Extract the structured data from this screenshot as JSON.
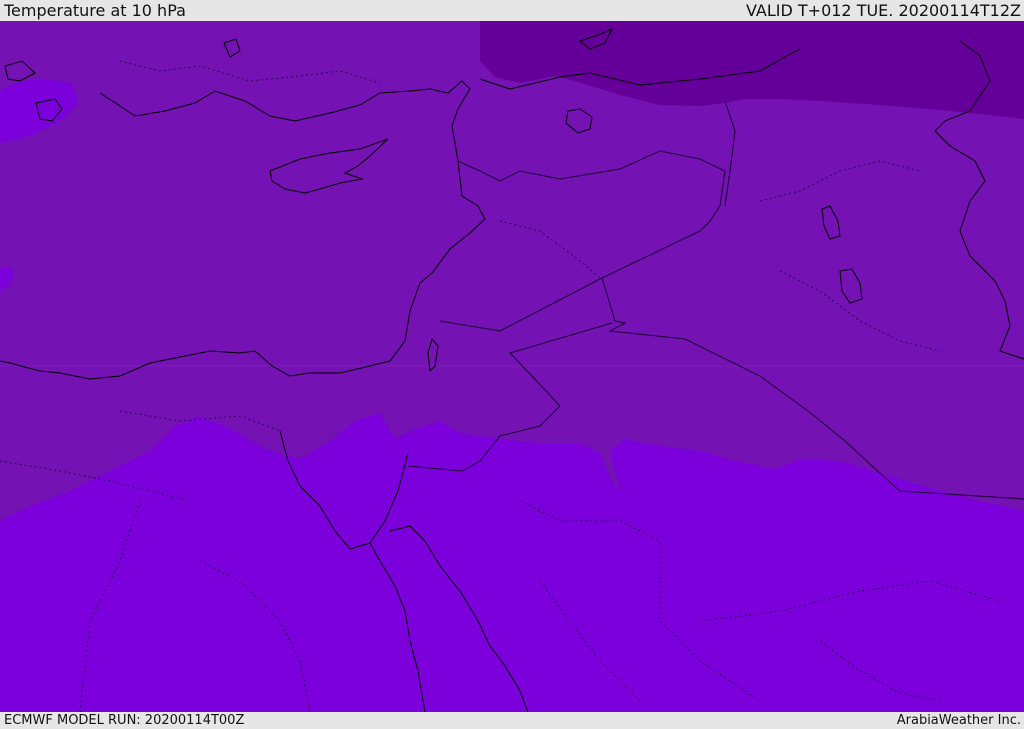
{
  "header": {
    "title": "Temperature at 10 hPa",
    "valid_time": "VALID T+012 TUE. 20200114T12Z"
  },
  "footer": {
    "model_run": "ECMWF MODEL RUN: 20200114T00Z",
    "credit": "ArabiaWeather Inc."
  },
  "map": {
    "colors": {
      "band_cold": "#640099",
      "band_mid": "#7412b3",
      "band_warm": "#7b00db",
      "coastline": "#000000",
      "borders": "#1a0033"
    }
  }
}
